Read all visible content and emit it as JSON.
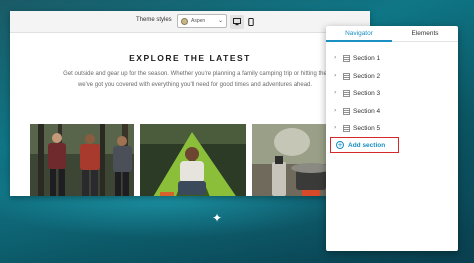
{
  "toolbar": {
    "theme_label": "Theme styles",
    "theme_value": "Aspen",
    "devices": [
      "desktop-icon",
      "mobile-icon"
    ]
  },
  "page": {
    "headline": "EXPLORE THE LATEST",
    "body": "Get outside and gear up for the season. Whether you're planning a family camping trip or hitting the we've got you covered with everything you'll need for good times and adventures ahead.",
    "body_line1": "Get outside and gear up for the season. Whether you're planning a family camping trip or hitting the",
    "body_line2": "we've got you covered with everything you'll need for good times and adventures ahead.",
    "photos": [
      "hikers-in-forest-photo",
      "man-sitting-by-tent-photo",
      "camp-stove-cooking-photo"
    ]
  },
  "panel": {
    "tabs": [
      "Navigator",
      "Elements"
    ],
    "active_tab": "Navigator",
    "sections": [
      "Section 1",
      "Section 2",
      "Section 3",
      "Section 4",
      "Section 5"
    ],
    "add_section_label": "Add section"
  },
  "colors": {
    "accent": "#1a8fc2",
    "highlight_border": "#d62828",
    "background": "#0f7686"
  }
}
